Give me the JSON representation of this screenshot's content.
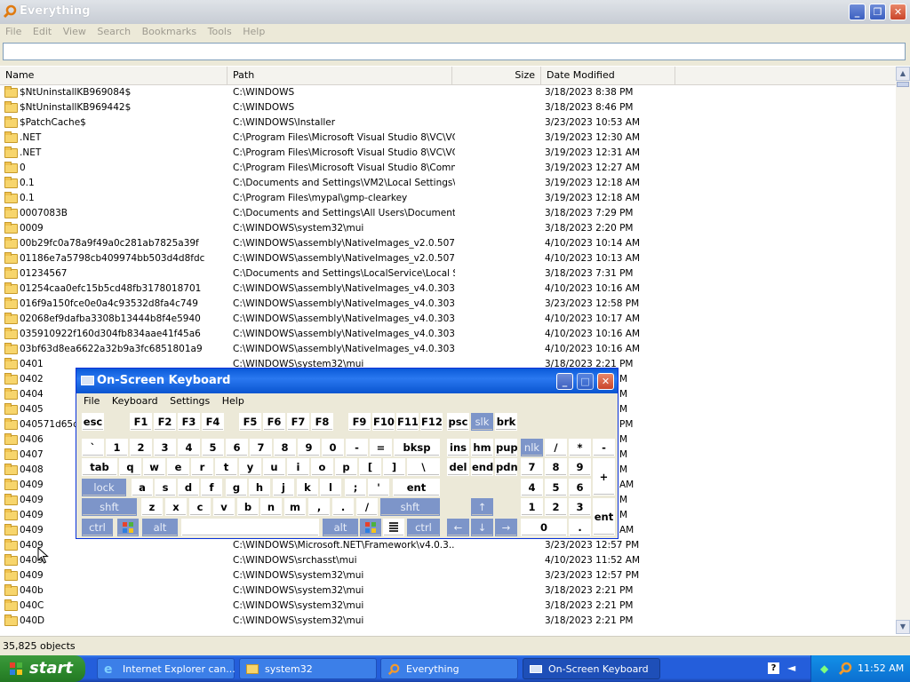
{
  "window": {
    "title": "Everything"
  },
  "menu": [
    "File",
    "Edit",
    "View",
    "Search",
    "Bookmarks",
    "Tools",
    "Help"
  ],
  "search": {
    "value": ""
  },
  "columns": {
    "name": "Name",
    "path": "Path",
    "size": "Size",
    "date": "Date Modified"
  },
  "rows": [
    {
      "name": "$NtUninstallKB969084$",
      "path": "C:\\WINDOWS",
      "date": "3/18/2023 8:38 PM"
    },
    {
      "name": "$NtUninstallKB969442$",
      "path": "C:\\WINDOWS",
      "date": "3/18/2023 8:46 PM"
    },
    {
      "name": "$PatchCache$",
      "path": "C:\\WINDOWS\\Installer",
      "date": "3/23/2023 10:53 AM"
    },
    {
      "name": ".NET",
      "path": "C:\\Program Files\\Microsoft Visual Studio 8\\VC\\VC...",
      "date": "3/19/2023 12:30 AM"
    },
    {
      "name": ".NET",
      "path": "C:\\Program Files\\Microsoft Visual Studio 8\\VC\\VC...",
      "date": "3/19/2023 12:31 AM"
    },
    {
      "name": "0",
      "path": "C:\\Program Files\\Microsoft Visual Studio 8\\Comm...",
      "date": "3/19/2023 12:27 AM"
    },
    {
      "name": "0.1",
      "path": "C:\\Documents and Settings\\VM2\\Local Settings\\T...",
      "date": "3/19/2023 12:18 AM"
    },
    {
      "name": "0.1",
      "path": "C:\\Program Files\\mypal\\gmp-clearkey",
      "date": "3/19/2023 12:18 AM"
    },
    {
      "name": "0007083B",
      "path": "C:\\Documents and Settings\\All Users\\Documents...",
      "date": "3/18/2023 7:29 PM"
    },
    {
      "name": "0009",
      "path": "C:\\WINDOWS\\system32\\mui",
      "date": "3/18/2023 2:20 PM"
    },
    {
      "name": "00b29fc0a78a9f49a0c281ab7825a39f",
      "path": "C:\\WINDOWS\\assembly\\NativeImages_v2.0.507...",
      "date": "4/10/2023 10:14 AM"
    },
    {
      "name": "01186e7a5798cb409974bb503d4d8fdc",
      "path": "C:\\WINDOWS\\assembly\\NativeImages_v2.0.507...",
      "date": "4/10/2023 10:13 AM"
    },
    {
      "name": "01234567",
      "path": "C:\\Documents and Settings\\LocalService\\Local S...",
      "date": "3/18/2023 7:31 PM"
    },
    {
      "name": "01254caa0efc15b5cd48fb3178018701",
      "path": "C:\\WINDOWS\\assembly\\NativeImages_v4.0.303...",
      "date": "4/10/2023 10:16 AM"
    },
    {
      "name": "016f9a150fce0e0a4c93532d8fa4c749",
      "path": "C:\\WINDOWS\\assembly\\NativeImages_v4.0.303...",
      "date": "3/23/2023 12:58 PM"
    },
    {
      "name": "02068ef9dafba3308b13444b8f4e5940",
      "path": "C:\\WINDOWS\\assembly\\NativeImages_v4.0.303...",
      "date": "4/10/2023 10:17 AM"
    },
    {
      "name": "035910922f160d304fb834aae41f45a6",
      "path": "C:\\WINDOWS\\assembly\\NativeImages_v4.0.303...",
      "date": "4/10/2023 10:16 AM"
    },
    {
      "name": "03bf63d8ea6622a32b9a3fc6851801a9",
      "path": "C:\\WINDOWS\\assembly\\NativeImages_v4.0.303...",
      "date": "4/10/2023 10:16 AM"
    },
    {
      "name": "0401",
      "path": "C:\\WINDOWS\\system32\\mui",
      "date": "3/18/2023 2:21 PM"
    },
    {
      "name": "0402",
      "path": "",
      "date": "M"
    },
    {
      "name": "0404",
      "path": "",
      "date": "M"
    },
    {
      "name": "0405",
      "path": "",
      "date": "M"
    },
    {
      "name": "040571d65dd",
      "path": "",
      "date": "PM"
    },
    {
      "name": "0406",
      "path": "",
      "date": "M"
    },
    {
      "name": "0407",
      "path": "",
      "date": "M"
    },
    {
      "name": "0408",
      "path": "",
      "date": "M"
    },
    {
      "name": "0409",
      "path": "",
      "date": "AM"
    },
    {
      "name": "0409",
      "path": "",
      "date": "M"
    },
    {
      "name": "0409",
      "path": "",
      "date": "M"
    },
    {
      "name": "0409",
      "path": "",
      "date": "AM"
    },
    {
      "name": "0409",
      "path": "C:\\WINDOWS\\Microsoft.NET\\Framework\\v4.0.3...",
      "date": "3/23/2023 12:57 PM"
    },
    {
      "name": "0409",
      "path": "C:\\WINDOWS\\srchasst\\mui",
      "date": "4/10/2023 11:52 AM"
    },
    {
      "name": "0409",
      "path": "C:\\WINDOWS\\system32\\mui",
      "date": "3/23/2023 12:57 PM"
    },
    {
      "name": "040b",
      "path": "C:\\WINDOWS\\system32\\mui",
      "date": "3/18/2023 2:21 PM"
    },
    {
      "name": "040C",
      "path": "C:\\WINDOWS\\system32\\mui",
      "date": "3/18/2023 2:21 PM"
    },
    {
      "name": "040D",
      "path": "C:\\WINDOWS\\system32\\mui",
      "date": "3/18/2023 2:21 PM"
    }
  ],
  "status": {
    "count": "35,825 objects"
  },
  "osk": {
    "title": "On-Screen Keyboard",
    "menu": [
      "File",
      "Keyboard",
      "Settings",
      "Help"
    ],
    "keys": {
      "esc": "esc",
      "f1": "F1",
      "f2": "F2",
      "f3": "F3",
      "f4": "F4",
      "f5": "F5",
      "f6": "F6",
      "f7": "F7",
      "f8": "F8",
      "f9": "F9",
      "f10": "F10",
      "f11": "F11",
      "f12": "F12",
      "psc": "psc",
      "slk": "slk",
      "brk": "brk",
      "backtick": "`",
      "n1": "1",
      "n2": "2",
      "n3": "3",
      "n4": "4",
      "n5": "5",
      "n6": "6",
      "n7": "7",
      "n8": "8",
      "n9": "9",
      "n0": "0",
      "minus": "-",
      "equals": "=",
      "bksp": "bksp",
      "ins": "ins",
      "hm": "hm",
      "pup": "pup",
      "nlk": "nlk",
      "kpslash": "/",
      "kpstar": "*",
      "kpminus": "-",
      "tab": "tab",
      "q": "q",
      "w": "w",
      "e": "e",
      "r": "r",
      "t": "t",
      "y": "y",
      "u": "u",
      "i": "i",
      "o": "o",
      "p": "p",
      "lbracket": "[",
      "rbracket": "]",
      "backslash": "\\",
      "del": "del",
      "end": "end",
      "pdn": "pdn",
      "kp7": "7",
      "kp8": "8",
      "kp9": "9",
      "kpplus": "+",
      "lock": "lock",
      "a": "a",
      "s": "s",
      "d": "d",
      "f": "f",
      "g": "g",
      "h": "h",
      "j": "j",
      "k": "k",
      "l": "l",
      "semicolon": ";",
      "quote": "'",
      "ent": "ent",
      "kp4": "4",
      "kp5": "5",
      "kp6": "6",
      "shft": "shft",
      "z": "z",
      "x": "x",
      "c": "c",
      "v": "v",
      "b": "b",
      "n": "n",
      "m": "m",
      "comma": ",",
      "period": ".",
      "slash": "/",
      "rshft": "shft",
      "up": "↑",
      "kp1": "1",
      "kp2": "2",
      "kp3": "3",
      "kpent": "ent",
      "ctrl": "ctrl",
      "alt": "alt",
      "ralt": "alt",
      "rctrl": "ctrl",
      "left": "←",
      "down": "↓",
      "right": "→",
      "kp0": "0",
      "kpdot": "."
    }
  },
  "taskbar": {
    "start": "start",
    "tasks": [
      "Internet Explorer can...",
      "system32",
      "Everything",
      "On-Screen Keyboard"
    ],
    "clock": "11:52 AM"
  }
}
